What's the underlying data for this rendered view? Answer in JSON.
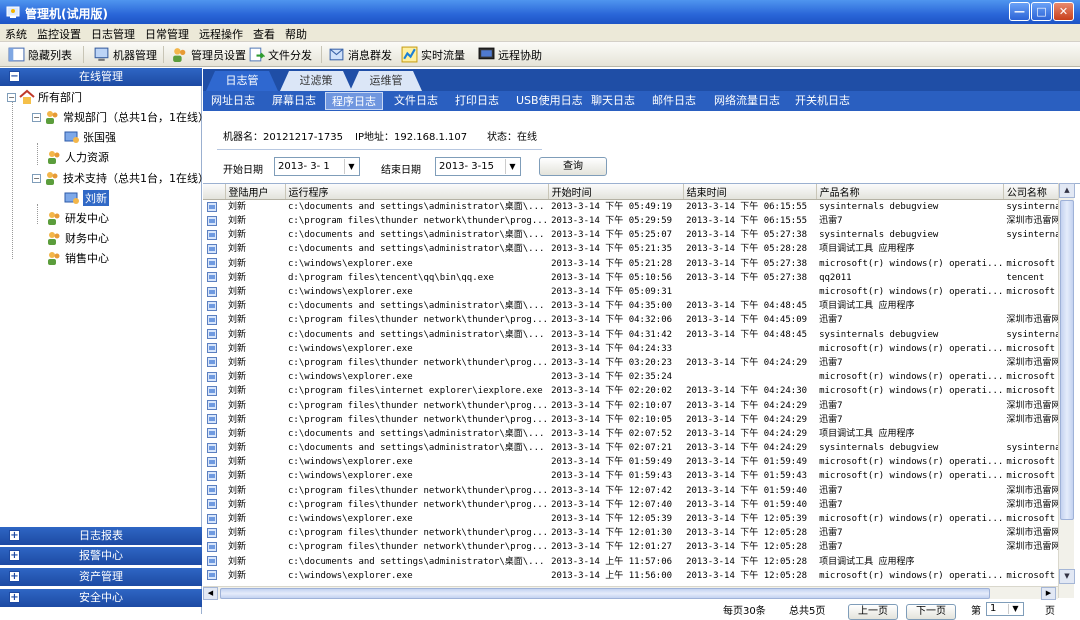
{
  "window": {
    "title": "管理机(试用版)",
    "min": "—",
    "max": "□",
    "close": "✕"
  },
  "menu": [
    "系统",
    "监控设置",
    "日志管理",
    "日常管理",
    "远程操作",
    "查看",
    "帮助"
  ],
  "toolbar": [
    {
      "label": "隐藏列表",
      "icon": "list-icon"
    },
    {
      "label": "机器管理",
      "icon": "computer-icon"
    },
    {
      "label": "管理员设置",
      "icon": "users-icon"
    },
    {
      "label": "文件分发",
      "icon": "file-send-icon"
    },
    {
      "label": "消息群发",
      "icon": "message-icon"
    },
    {
      "label": "实时流量",
      "icon": "traffic-icon"
    },
    {
      "label": "远程协助",
      "icon": "remote-icon"
    }
  ],
  "sidebar": {
    "header": "在线管理",
    "tree": {
      "root": "所有部门",
      "dept1": "常规部门（总共1台，1在线）",
      "dept1_user": "张国强",
      "dept2": "人力资源",
      "dept3": "技术支持（总共1台，1在线）",
      "dept3_user": "刘新",
      "dept4": "研发中心",
      "dept5": "财务中心",
      "dept6": "销售中心"
    },
    "sections": [
      "日志报表",
      "报警中心",
      "资产管理",
      "安全中心"
    ]
  },
  "tabs1": [
    "日志管理",
    "过滤策略",
    "运维管理"
  ],
  "tabs2": [
    "网址日志",
    "屏幕日志",
    "程序日志",
    "文件日志",
    "打印日志",
    "USB使用日志",
    "聊天日志",
    "邮件日志",
    "网络流量日志",
    "开关机日志"
  ],
  "info": {
    "machine": "机器名：20121217-1735",
    "ip": "IP地址：192.168.1.107",
    "state": "状态：在线"
  },
  "filter": {
    "start_label": "开始日期",
    "start_value": "2013- 3- 1",
    "end_label": "结束日期",
    "end_value": "2013- 3-15",
    "query": "查询"
  },
  "table": {
    "headers": [
      "登陆用户",
      "运行程序",
      "开始时间",
      "结束时间",
      "产品名称",
      "公司名称"
    ],
    "rows": [
      [
        "刘新",
        "c:\\documents and settings\\administrator\\桌面\\...",
        "2013-3-14 下午 05:49:19",
        "2013-3-14 下午 06:15:55",
        "sysinternals debugview",
        "sysinternals"
      ],
      [
        "刘新",
        "c:\\program files\\thunder network\\thunder\\prog...",
        "2013-3-14 下午 05:29:59",
        "2013-3-14 下午 06:15:55",
        "迅雷7",
        "深圳市迅雷网"
      ],
      [
        "刘新",
        "c:\\documents and settings\\administrator\\桌面\\...",
        "2013-3-14 下午 05:25:07",
        "2013-3-14 下午 05:27:38",
        "sysinternals debugview",
        "sysinternals"
      ],
      [
        "刘新",
        "c:\\documents and settings\\administrator\\桌面\\...",
        "2013-3-14 下午 05:21:35",
        "2013-3-14 下午 05:28:28",
        "项目调试工具 应用程序",
        ""
      ],
      [
        "刘新",
        "c:\\windows\\explorer.exe",
        "2013-3-14 下午 05:21:28",
        "2013-3-14 下午 05:27:38",
        "microsoft(r) windows(r) operati...",
        "microsoft co"
      ],
      [
        "刘新",
        "d:\\program files\\tencent\\qq\\bin\\qq.exe",
        "2013-3-14 下午 05:10:56",
        "2013-3-14 下午 05:27:38",
        "qq2011",
        "tencent"
      ],
      [
        "刘新",
        "c:\\windows\\explorer.exe",
        "2013-3-14 下午 05:09:31",
        "",
        "microsoft(r) windows(r) operati...",
        "microsoft co"
      ],
      [
        "刘新",
        "c:\\documents and settings\\administrator\\桌面\\...",
        "2013-3-14 下午 04:35:00",
        "2013-3-14 下午 04:48:45",
        "项目调试工具 应用程序",
        ""
      ],
      [
        "刘新",
        "c:\\program files\\thunder network\\thunder\\prog...",
        "2013-3-14 下午 04:32:06",
        "2013-3-14 下午 04:45:09",
        "迅雷7",
        "深圳市迅雷网"
      ],
      [
        "刘新",
        "c:\\documents and settings\\administrator\\桌面\\...",
        "2013-3-14 下午 04:31:42",
        "2013-3-14 下午 04:48:45",
        "sysinternals debugview",
        "sysinternals"
      ],
      [
        "刘新",
        "c:\\windows\\explorer.exe",
        "2013-3-14 下午 04:24:33",
        "",
        "microsoft(r) windows(r) operati...",
        "microsoft co"
      ],
      [
        "刘新",
        "c:\\program files\\thunder network\\thunder\\prog...",
        "2013-3-14 下午 03:20:23",
        "2013-3-14 下午 04:24:29",
        "迅雷7",
        "深圳市迅雷网"
      ],
      [
        "刘新",
        "c:\\windows\\explorer.exe",
        "2013-3-14 下午 02:35:24",
        "",
        "microsoft(r) windows(r) operati...",
        "microsoft co"
      ],
      [
        "刘新",
        "c:\\program files\\internet explorer\\iexplore.exe",
        "2013-3-14 下午 02:20:02",
        "2013-3-14 下午 04:24:30",
        "microsoft(r) windows(r) operati...",
        "microsoft co"
      ],
      [
        "刘新",
        "c:\\program files\\thunder network\\thunder\\prog...",
        "2013-3-14 下午 02:10:07",
        "2013-3-14 下午 04:24:29",
        "迅雷7",
        "深圳市迅雷网"
      ],
      [
        "刘新",
        "c:\\program files\\thunder network\\thunder\\prog...",
        "2013-3-14 下午 02:10:05",
        "2013-3-14 下午 04:24:29",
        "迅雷7",
        "深圳市迅雷网"
      ],
      [
        "刘新",
        "c:\\documents and settings\\administrator\\桌面\\...",
        "2013-3-14 下午 02:07:52",
        "2013-3-14 下午 04:24:29",
        "项目调试工具 应用程序",
        ""
      ],
      [
        "刘新",
        "c:\\documents and settings\\administrator\\桌面\\...",
        "2013-3-14 下午 02:07:21",
        "2013-3-14 下午 04:24:29",
        "sysinternals debugview",
        "sysinternals"
      ],
      [
        "刘新",
        "c:\\windows\\explorer.exe",
        "2013-3-14 下午 01:59:49",
        "2013-3-14 下午 01:59:49",
        "microsoft(r) windows(r) operati...",
        "microsoft co"
      ],
      [
        "刘新",
        "c:\\windows\\explorer.exe",
        "2013-3-14 下午 01:59:43",
        "2013-3-14 下午 01:59:43",
        "microsoft(r) windows(r) operati...",
        "microsoft co"
      ],
      [
        "刘新",
        "c:\\program files\\thunder network\\thunder\\prog...",
        "2013-3-14 下午 12:07:42",
        "2013-3-14 下午 01:59:40",
        "迅雷7",
        "深圳市迅雷网"
      ],
      [
        "刘新",
        "c:\\program files\\thunder network\\thunder\\prog...",
        "2013-3-14 下午 12:07:40",
        "2013-3-14 下午 01:59:40",
        "迅雷7",
        "深圳市迅雷网"
      ],
      [
        "刘新",
        "c:\\windows\\explorer.exe",
        "2013-3-14 下午 12:05:39",
        "2013-3-14 下午 12:05:39",
        "microsoft(r) windows(r) operati...",
        "microsoft co"
      ],
      [
        "刘新",
        "c:\\program files\\thunder network\\thunder\\prog...",
        "2013-3-14 下午 12:01:30",
        "2013-3-14 下午 12:05:28",
        "迅雷7",
        "深圳市迅雷网"
      ],
      [
        "刘新",
        "c:\\program files\\thunder network\\thunder\\prog...",
        "2013-3-14 下午 12:01:27",
        "2013-3-14 下午 12:05:28",
        "迅雷7",
        "深圳市迅雷网"
      ],
      [
        "刘新",
        "c:\\documents and settings\\administrator\\桌面\\...",
        "2013-3-14 上午 11:57:06",
        "2013-3-14 下午 12:05:28",
        "项目调试工具 应用程序",
        ""
      ],
      [
        "刘新",
        "c:\\windows\\explorer.exe",
        "2013-3-14 上午 11:56:00",
        "2013-3-14 下午 12:05:28",
        "microsoft(r) windows(r) operati...",
        "microsoft co"
      ]
    ]
  },
  "pager": {
    "per_page": "每页30条",
    "total": "总共5页",
    "prev": "上一页",
    "next": "下一页",
    "goto": "第",
    "page_suffix": "页",
    "page_value": "1"
  },
  "colors": {
    "titlebar": "#2a66d8",
    "tab_bar": "#1f4ea6",
    "selected": "#3169c6"
  }
}
